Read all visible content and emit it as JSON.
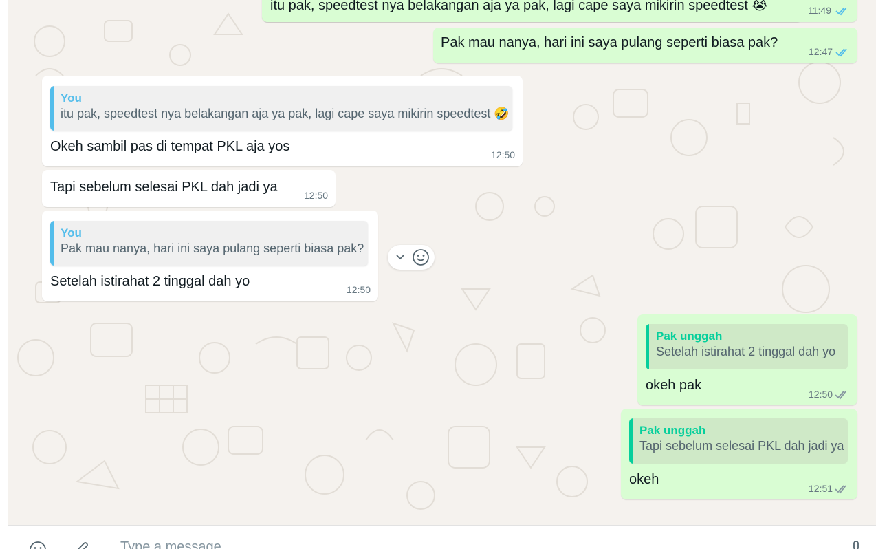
{
  "colors": {
    "outgoing_bubble": "#d9fdd3",
    "incoming_bubble": "#ffffff",
    "quote_you": "#53bdeb",
    "quote_other": "#06cf9c",
    "read_tick": "#53bdeb",
    "delivered_tick": "#8696a0",
    "chat_background": "#f5f2ee"
  },
  "messages": [
    {
      "direction": "out",
      "text": "itu pak, speedtest nya belakangan aja ya pak, lagi cape saya mikirin speedtest 😭",
      "time": "11:49",
      "status": "read"
    },
    {
      "direction": "out",
      "text": "Pak mau nanya, hari ini saya pulang seperti biasa pak?",
      "time": "12:47",
      "status": "read"
    },
    {
      "direction": "in",
      "quote_author": "You",
      "quote_text": "itu pak, speedtest nya belakangan aja ya pak, lagi cape saya mikirin speedtest 🤣",
      "text": "Okeh sambil pas di tempat PKL aja yos",
      "time": "12:50"
    },
    {
      "direction": "in",
      "text": "Tapi sebelum selesai PKL dah jadi ya",
      "time": "12:50"
    },
    {
      "direction": "in",
      "quote_author": "You",
      "quote_text": "Pak mau nanya, hari ini saya pulang seperti biasa pak?",
      "text": "Setelah istirahat 2 tinggal dah yo",
      "time": "12:50"
    },
    {
      "direction": "out",
      "quote_author": "Pak unggah",
      "quote_text": "Setelah istirahat 2 tinggal dah yo",
      "text": "okeh pak",
      "time": "12:50",
      "status": "delivered"
    },
    {
      "direction": "out",
      "quote_author": "Pak unggah",
      "quote_text": "Tapi sebelum selesai PKL dah jadi ya",
      "text": "okeh",
      "time": "12:51",
      "status": "delivered"
    }
  ],
  "hover_actions": {
    "icons": [
      "chevron-down-icon",
      "emoji-icon"
    ]
  },
  "composer": {
    "placeholder": "Type a message",
    "icons": [
      "emoji-icon",
      "attach-icon",
      "mic-icon"
    ]
  }
}
